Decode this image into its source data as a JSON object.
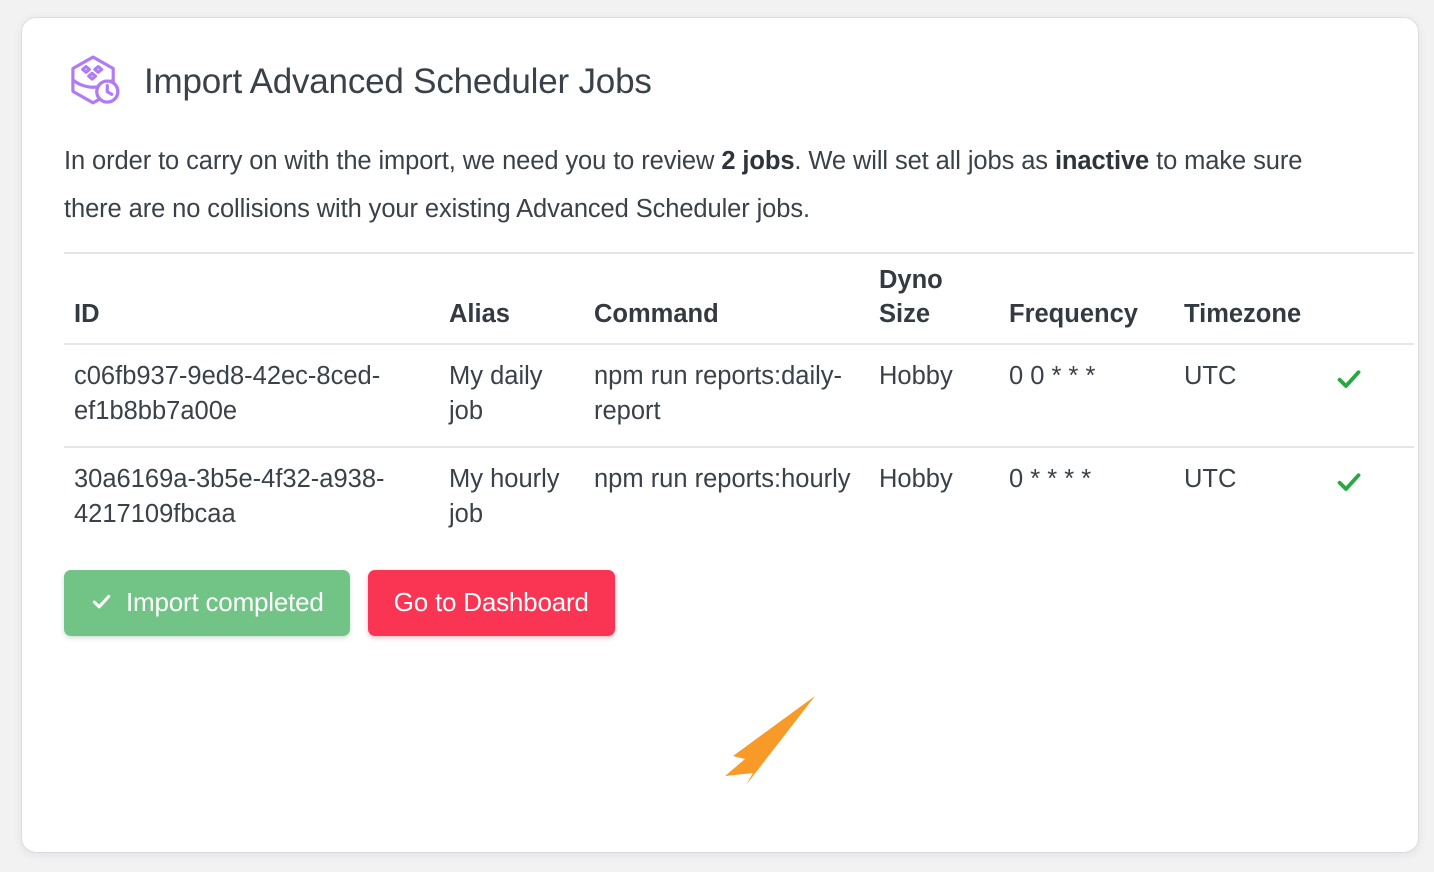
{
  "header": {
    "title": "Import Advanced Scheduler Jobs",
    "icon": "scheduler-cube-clock-icon"
  },
  "intro": {
    "part1": "In order to carry on with the import, we need you to review ",
    "bold1": "2 jobs",
    "part2": ". We will set all jobs as ",
    "bold2": "inactive",
    "part3": " to make sure there are no collisions with your existing Advanced Scheduler jobs."
  },
  "table": {
    "columns": [
      {
        "key": "id",
        "label": "ID"
      },
      {
        "key": "alias",
        "label": "Alias"
      },
      {
        "key": "command",
        "label": "Command"
      },
      {
        "key": "dyno_size",
        "label": "Dyno Size"
      },
      {
        "key": "frequency",
        "label": "Frequency"
      },
      {
        "key": "timezone",
        "label": "Timezone"
      },
      {
        "key": "status",
        "label": ""
      }
    ],
    "rows": [
      {
        "id": "c06fb937-9ed8-42ec-8ced-ef1b8bb7a00e",
        "alias": "My daily job",
        "command": "npm run reports:daily-report",
        "dyno_size": "Hobby",
        "frequency": "0 0 * * *",
        "timezone": "UTC",
        "status_icon": "check-icon"
      },
      {
        "id": "30a6169a-3b5e-4f32-a938-4217109fbcaa",
        "alias": "My hourly job",
        "command": "npm run reports:hourly",
        "dyno_size": "Hobby",
        "frequency": "0 * * * *",
        "timezone": "UTC",
        "status_icon": "check-icon"
      }
    ]
  },
  "actions": {
    "import_completed_label": "Import completed",
    "go_to_dashboard_label": "Go to Dashboard"
  },
  "colors": {
    "brand_purple": "#b07cf5",
    "success_green": "#71c486",
    "danger_red": "#fa3553",
    "check_green": "#28a745",
    "annotation_orange": "#f79a28",
    "text": "#3b4149",
    "divider": "#e3e5e8",
    "page_background": "#f2f2f3",
    "card_background": "#ffffff"
  }
}
